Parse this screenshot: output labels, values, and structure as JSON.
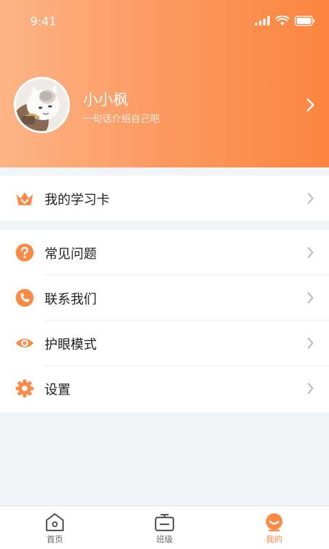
{
  "status_bar": {
    "time": "9:41"
  },
  "profile": {
    "name": "小小枫",
    "bio": "一句话介绍自己吧"
  },
  "menu_card_1": {
    "items": [
      {
        "label": "我的学习卡",
        "icon": "crown-icon"
      }
    ]
  },
  "menu_card_2": {
    "items": [
      {
        "label": "常见问题",
        "icon": "question-icon"
      },
      {
        "label": "联系我们",
        "icon": "phone-icon"
      },
      {
        "label": "护眼模式",
        "icon": "eye-icon"
      },
      {
        "label": "设置",
        "icon": "gear-icon"
      }
    ]
  },
  "tabbar": {
    "tabs": [
      {
        "label": "首页",
        "icon": "home-icon",
        "active": false
      },
      {
        "label": "班级",
        "icon": "tv-icon",
        "active": false
      },
      {
        "label": "我的",
        "icon": "profile-face-icon",
        "active": true
      }
    ]
  },
  "colors": {
    "accent": "#fb8a45",
    "header_start": "#fdb487",
    "header_end": "#fb8540",
    "background": "#f1f4f7"
  }
}
